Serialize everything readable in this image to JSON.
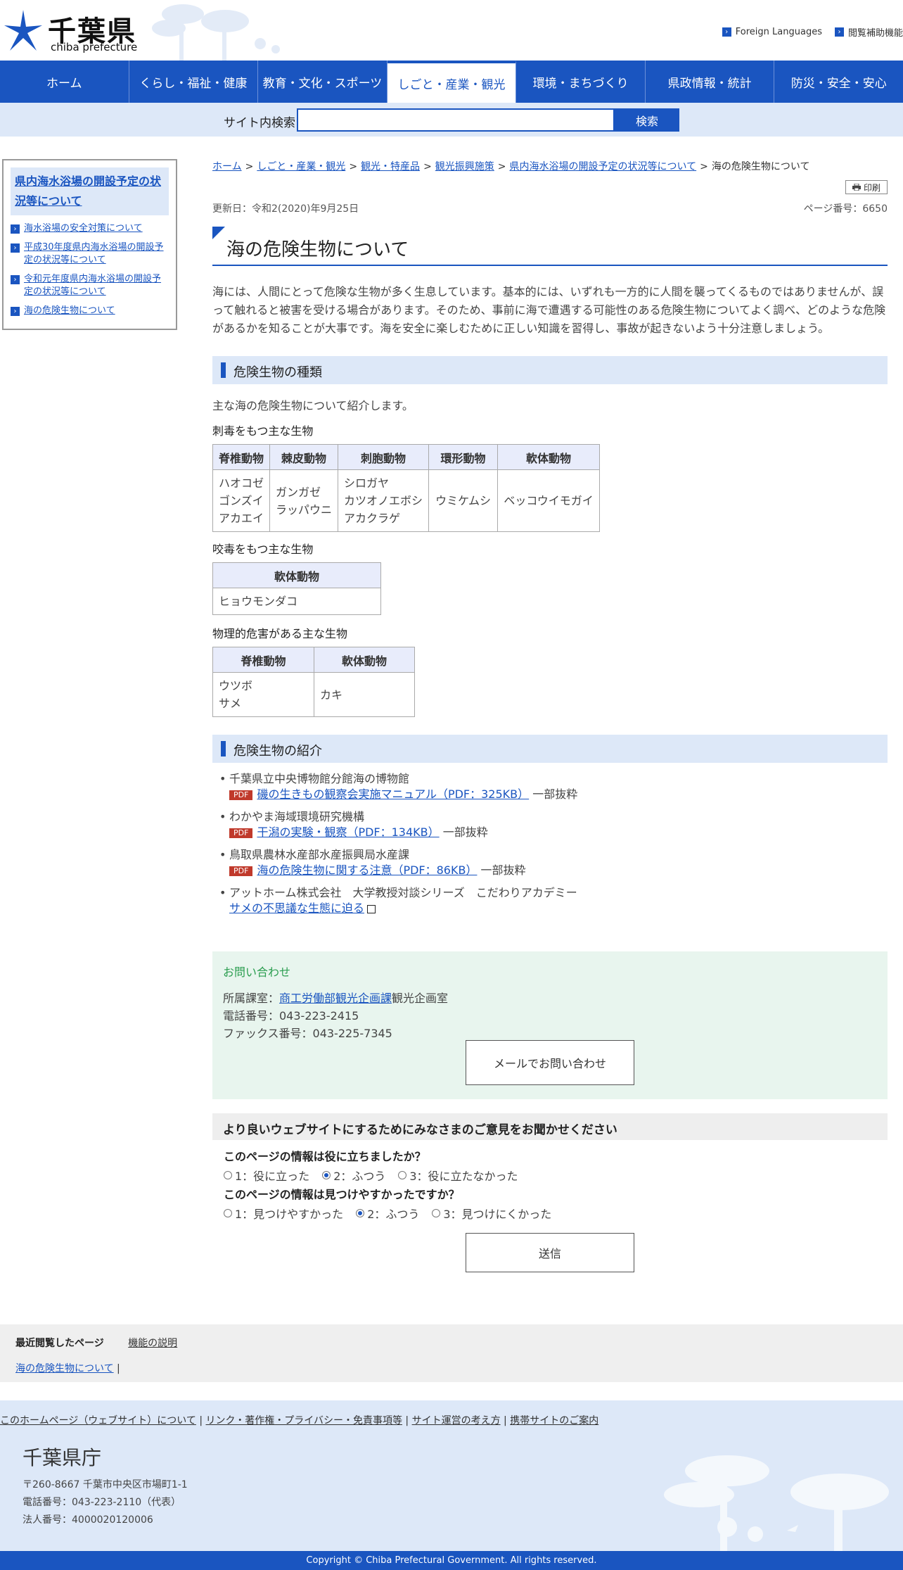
{
  "header": {
    "logo_kanji": "千葉県",
    "logo_roman": "chiba prefecture",
    "foreign_languages": "Foreign Languages",
    "accessibility": "閲覧補助機能"
  },
  "nav": {
    "items": [
      {
        "label": "ホーム"
      },
      {
        "label": "くらし・福祉・健康"
      },
      {
        "label": "教育・文化・スポーツ"
      },
      {
        "label": "しごと・産業・観光"
      },
      {
        "label": "環境・まちづくり"
      },
      {
        "label": "県政情報・統計"
      },
      {
        "label": "防災・安全・安心"
      }
    ]
  },
  "search": {
    "label": "サイト内検索",
    "button": "検索",
    "value": ""
  },
  "sidebar": {
    "title": "県内海水浴場の開設予定の状況等について",
    "items": [
      {
        "label": "海水浴場の安全対策について"
      },
      {
        "label": "平成30年度県内海水浴場の開設予定の状況等について"
      },
      {
        "label": "令和元年度県内海水浴場の開設予定の状況等について"
      },
      {
        "label": "海の危険生物について"
      }
    ]
  },
  "breadcrumb": {
    "items": [
      "ホーム",
      "しごと・産業・観光",
      "観光・特産品",
      "観光振興施策",
      "県内海水浴場の開設予定の状況等について"
    ],
    "current": "海の危険生物について",
    "sep": ">"
  },
  "print_label": "印刷",
  "meta": {
    "updated": "更新日：令和2(2020)年9月25日",
    "page_number": "ページ番号：6650"
  },
  "title": "海の危険生物について",
  "intro": "海には、人間にとって危険な生物が多く生息しています。基本的には、いずれも一方的に人間を襲ってくるものではありませんが、誤って触れると被害を受ける場合があります。そのため、事前に海で遭遇する可能性のある危険生物についてよく調べ、どのような危険があるかを知ることが大事です。海を安全に楽しむために正しい知識を習得し、事故が起きないよう十分注意しましょう。",
  "section1": {
    "heading": "危険生物の種類",
    "lead": "主な海の危険生物について紹介します。",
    "table1": {
      "caption": "刺毒をもつ主な生物",
      "headers": [
        "脊椎動物",
        "棘皮動物",
        "刺胞動物",
        "環形動物",
        "軟体動物"
      ],
      "cells": [
        [
          "ハオコゼ",
          "ゴンズイ",
          "アカエイ"
        ],
        [
          "ガンガゼ",
          "ラッパウニ"
        ],
        [
          "シロガヤ",
          "カツオノエボシ",
          "アカクラゲ"
        ],
        [
          "ウミケムシ"
        ],
        [
          "ベッコウイモガイ"
        ]
      ]
    },
    "table2": {
      "caption": "咬毒をもつ主な生物",
      "headers": [
        "軟体動物"
      ],
      "cells": [
        [
          "ヒョウモンダコ"
        ]
      ]
    },
    "table3": {
      "caption": "物理的危害がある主な生物",
      "headers": [
        "脊椎動物",
        "軟体動物"
      ],
      "cells": [
        [
          "ウツボ",
          "サメ"
        ],
        [
          "カキ"
        ]
      ]
    }
  },
  "section2": {
    "heading": "危険生物の紹介",
    "items": [
      {
        "org": "千葉県立中央博物館分館海の博物館",
        "link": "磯の生きもの観察会実施マニュアル（PDF：325KB）",
        "suffix": "一部抜粋",
        "pdf": "PDF"
      },
      {
        "org": "わかやま海域環境研究機構",
        "link": "干潟の実験・観察（PDF：134KB）",
        "suffix": "一部抜粋",
        "pdf": "PDF"
      },
      {
        "org": "鳥取県農林水産部水産振興局水産課",
        "link": "海の危険生物に関する注意（PDF：86KB）",
        "suffix": "一部抜粋",
        "pdf": "PDF"
      },
      {
        "org": "アットホーム株式会社　大学教授対談シリーズ　こだわりアカデミー",
        "link": "サメの不思議な生態に迫る"
      }
    ]
  },
  "contact": {
    "title": "お問い合わせ",
    "dept_prefix": "所属課室：",
    "dept_link": "商工労働部観光企画課",
    "dept_suffix": "観光企画室",
    "phone": "電話番号：043-223-2415",
    "fax": "ファックス番号：043-225-7345",
    "mail_button": "メールでお問い合わせ"
  },
  "survey": {
    "heading": "より良いウェブサイトにするためにみなさまのご意見をお聞かせください",
    "q1": "このページの情報は役に立ちましたか？",
    "q1_opts": [
      "1：役に立った",
      "2：ふつう",
      "3：役に立たなかった"
    ],
    "q1_selected": 1,
    "q2": "このページの情報は見つけやすかったですか？",
    "q2_opts": [
      "1：見つけやすかった",
      "2：ふつう",
      "3：見つけにくかった"
    ],
    "q2_selected": 1,
    "submit": "送信"
  },
  "recent": {
    "title": "最近閲覧したページ",
    "help": "機能の説明",
    "item": "海の危険生物について"
  },
  "footer": {
    "links": [
      "このホームページ（ウェブサイト）について",
      "リンク・著作権・プライバシー・免責事項等",
      "サイト運営の考え方",
      "携帯サイトのご案内"
    ],
    "org": "千葉県庁",
    "address": "〒260-8667 千葉市中央区市場町1-1",
    "phone": "電話番号：043-223-2110（代表）",
    "corp_no": "法人番号：4000020120006",
    "copyright": "Copyright © Chiba Prefectural Government. All rights reserved."
  },
  "colors": {
    "brand": "#1a55c0",
    "light_blue": "#dde8f8",
    "contact_bg": "#e8f5ee"
  }
}
